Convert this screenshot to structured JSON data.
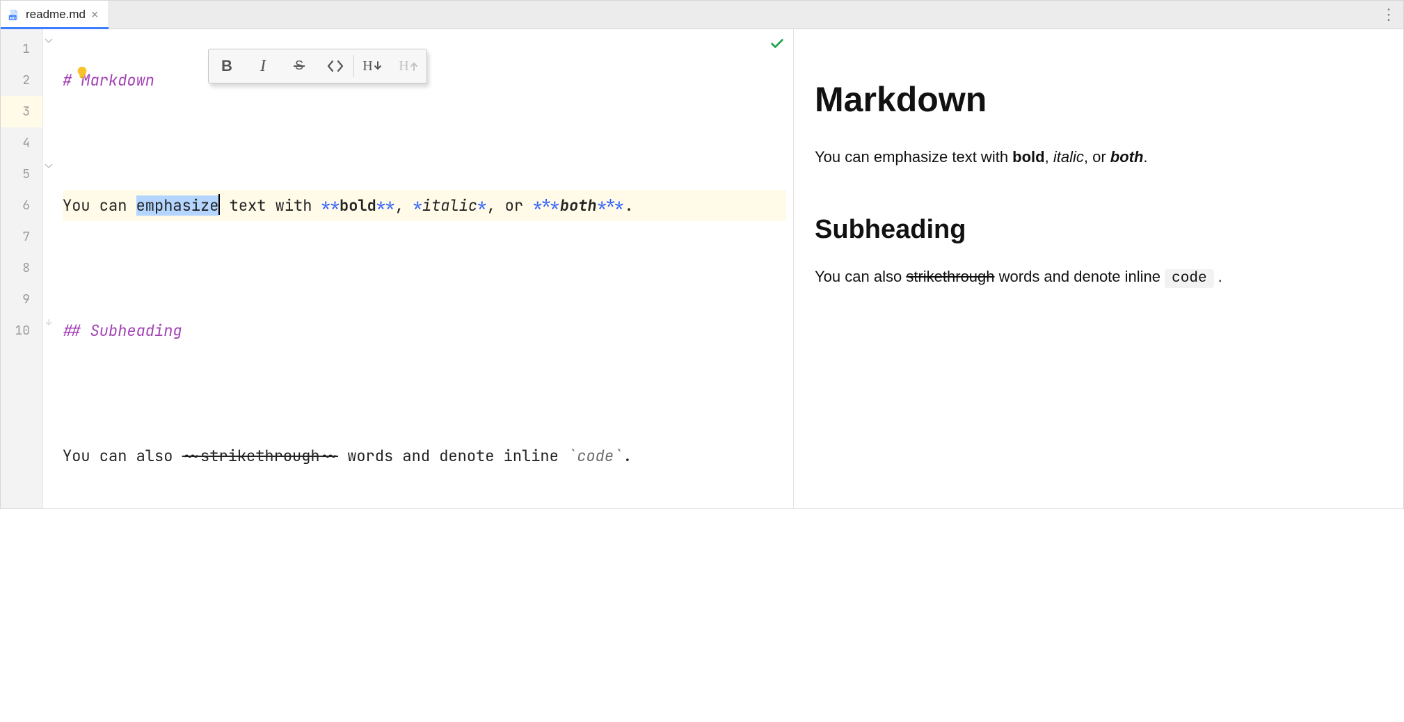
{
  "tabs": [
    {
      "filename": "readme.md",
      "active": true
    }
  ],
  "editor": {
    "line_count": 10,
    "active_line": 3,
    "selection_word": "emphasize",
    "lightbulb_visible": true,
    "fold_markers": [
      1,
      5,
      10
    ],
    "line1": {
      "hash": "# ",
      "text": "Markdown"
    },
    "line3": {
      "pre": "You can ",
      "sel": "emphasize",
      "mid1": " text with ",
      "star2a": "**",
      "bold": "bold",
      "star2b": "**",
      "c1": ", ",
      "star1a": "*",
      "italic": "italic",
      "star1b": "*",
      "c2": ", or ",
      "star3a": "***",
      "both": "both",
      "star3b": "***",
      "end": "."
    },
    "line5": {
      "hash": "## ",
      "text": "Subheading"
    },
    "line7": {
      "pre": "You can also ",
      "t1": "~~",
      "strike": "strikethrough",
      "t2": "~~",
      "mid": " words and denote inline ",
      "bt1": "`",
      "code": "code",
      "bt2": "`",
      "end": "."
    }
  },
  "toolbar": {
    "bold": "B",
    "heading_down": "H",
    "heading_up": "H"
  },
  "status": {
    "checkmark": true
  },
  "preview": {
    "h1": "Markdown",
    "p1_a": "You can emphasize text with ",
    "p1_bold": "bold",
    "p1_b": ", ",
    "p1_italic": "italic",
    "p1_c": ", or ",
    "p1_both": "both",
    "p1_d": ".",
    "h2": "Subheading",
    "p2_a": "You can also ",
    "p2_strike": "strikethrough",
    "p2_b": " words and denote inline ",
    "p2_code": "code",
    "p2_c": " ."
  }
}
